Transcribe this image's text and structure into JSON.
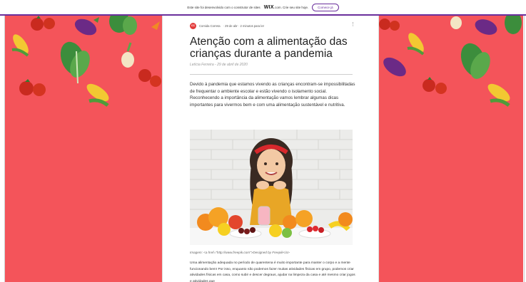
{
  "wix_banner": {
    "text": "Este site foi desenvolvido com o construtor de sites",
    "brand": "WIX",
    "text_after": ".com. Crie seu site hoje.",
    "cta_label": "Comece já"
  },
  "post": {
    "author_initials": "CC",
    "author_name": "Comida Correta",
    "meta": "· 29 de abr · 2 minutos para ler",
    "more_icon": "⋮",
    "title": "Atenção com a alimentação das crianças durante a pandemia",
    "byline": "Letícia Ferreira - 29 de abril de 2020",
    "intro": "Devido à pandemia que estamos vivendo as crianças encontram-se impossibilitadas de frequentar o ambiente escolar e estão vivendo o isolamento social. Reconhecendo a importância da alimentação vamos lembrar algumas dicas importantes para vivermos bem e com uma alimentação sustentável e nutritiva.",
    "caption": "Imagem: <a href=\"http://www.freepik.com\">Designed by Freepik</a>",
    "body_2": "Uma alimentação adequada no período de quarentena é muito importante para manter o corpo e a mente funcionando bem! Por isso, enquanto não podemos fazer muitas atividades físicas em grupo, podemos criar atividades físicas em casa, como subir e descer degraus, ajudar na limpeza da casa e até mesmo criar jogos e atividades que"
  },
  "colors": {
    "side_background": "#f4545a",
    "wix_accent": "#6a2f9c",
    "avatar": "#e23b3b"
  }
}
